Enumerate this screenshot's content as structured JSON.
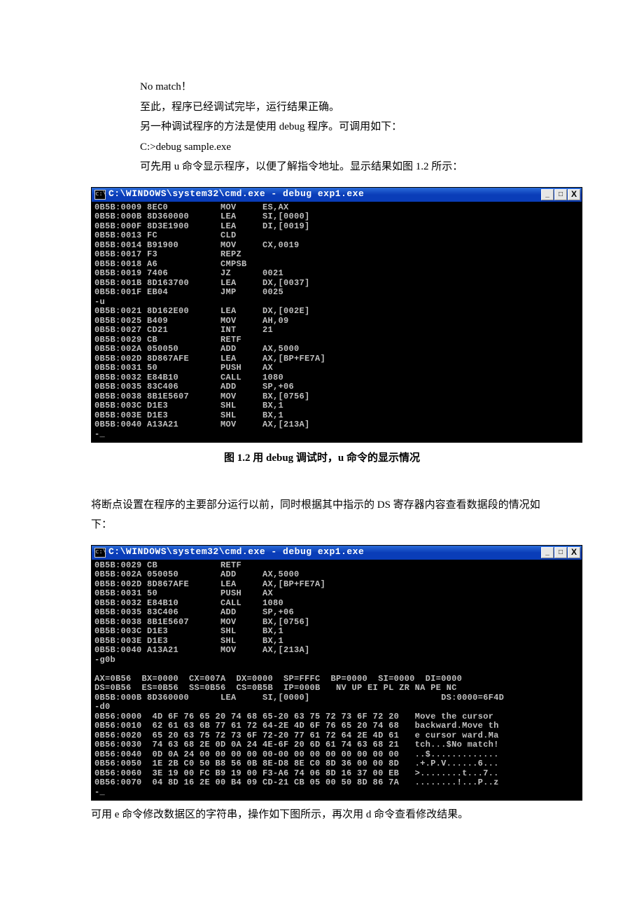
{
  "intro": {
    "l1": "No match！",
    "l2": "至此，程序已经调试完毕，运行结果正确。",
    "l3": "另一种调试程序的方法是使用 debug 程序。可调用如下：",
    "l4": "C:>debug sample.exe",
    "l5": "可先用 u 命令显示程序，以便了解指令地址。显示结果如图 1.2 所示："
  },
  "term1": {
    "title": "C:\\WINDOWS\\system32\\cmd.exe - debug exp1.exe",
    "body": "0B5B:0009 8EC0          MOV     ES,AX\n0B5B:000B 8D360000      LEA     SI,[0000]\n0B5B:000F 8D3E1900      LEA     DI,[0019]\n0B5B:0013 FC            CLD\n0B5B:0014 B91900        MOV     CX,0019\n0B5B:0017 F3            REPZ\n0B5B:0018 A6            CMPSB\n0B5B:0019 7406          JZ      0021\n0B5B:001B 8D163700      LEA     DX,[0037]\n0B5B:001F EB04          JMP     0025\n-u\n0B5B:0021 8D162E00      LEA     DX,[002E]\n0B5B:0025 B409          MOV     AH,09\n0B5B:0027 CD21          INT     21\n0B5B:0029 CB            RETF\n0B5B:002A 050050        ADD     AX,5000\n0B5B:002D 8D867AFE      LEA     AX,[BP+FE7A]\n0B5B:0031 50            PUSH    AX\n0B5B:0032 E84B10        CALL    1080\n0B5B:0035 83C406        ADD     SP,+06\n0B5B:0038 8B1E5607      MOV     BX,[0756]\n0B5B:003C D1E3          SHL     BX,1\n0B5B:003E D1E3          SHL     BX,1\n0B5B:0040 A13A21        MOV     AX,[213A]\n-_"
  },
  "caption1": "图 1.2   用 debug 调试时，u 命令的显示情况",
  "para2": "将断点设置在程序的主要部分运行以前，同时根据其中指示的 DS 寄存器内容查看数据段的情况如下：",
  "term2": {
    "title": "C:\\WINDOWS\\system32\\cmd.exe - debug exp1.exe",
    "body": "0B5B:0029 CB            RETF\n0B5B:002A 050050        ADD     AX,5000\n0B5B:002D 8D867AFE      LEA     AX,[BP+FE7A]\n0B5B:0031 50            PUSH    AX\n0B5B:0032 E84B10        CALL    1080\n0B5B:0035 83C406        ADD     SP,+06\n0B5B:0038 8B1E5607      MOV     BX,[0756]\n0B5B:003C D1E3          SHL     BX,1\n0B5B:003E D1E3          SHL     BX,1\n0B5B:0040 A13A21        MOV     AX,[213A]\n-g0b\n\nAX=0B56  BX=0000  CX=007A  DX=0000  SP=FFFC  BP=0000  SI=0000  DI=0000\nDS=0B56  ES=0B56  SS=0B56  CS=0B5B  IP=000B   NV UP EI PL ZR NA PE NC\n0B5B:000B 8D360000      LEA     SI,[0000]                         DS:0000=6F4D\n-d0\n0B56:0000  4D 6F 76 65 20 74 68 65-20 63 75 72 73 6F 72 20   Move the cursor\n0B56:0010  62 61 63 6B 77 61 72 64-2E 4D 6F 76 65 20 74 68   backward.Move th\n0B56:0020  65 20 63 75 72 73 6F 72-20 77 61 72 64 2E 4D 61   e cursor ward.Ma\n0B56:0030  74 63 68 2E 0D 0A 24 4E-6F 20 6D 61 74 63 68 21   tch...$No match!\n0B56:0040  0D 0A 24 00 00 00 00 00-00 00 00 00 00 00 00 00   ..$.............\n0B56:0050  1E 2B C0 50 B8 56 0B 8E-D8 8E C0 8D 36 00 00 8D   .+.P.V......6...\n0B56:0060  3E 19 00 FC B9 19 00 F3-A6 74 06 8D 16 37 00 EB   >........t...7..\n0B56:0070  04 8D 16 2E 00 B4 09 CD-21 CB 05 00 50 8D 86 7A   ........!...P..z\n-_"
  },
  "outro": "可用 e 命令修改数据区的字符串，操作如下图所示，再次用 d 命令查看修改结果。",
  "btn": {
    "min": "_",
    "max": "□",
    "close": "X"
  }
}
